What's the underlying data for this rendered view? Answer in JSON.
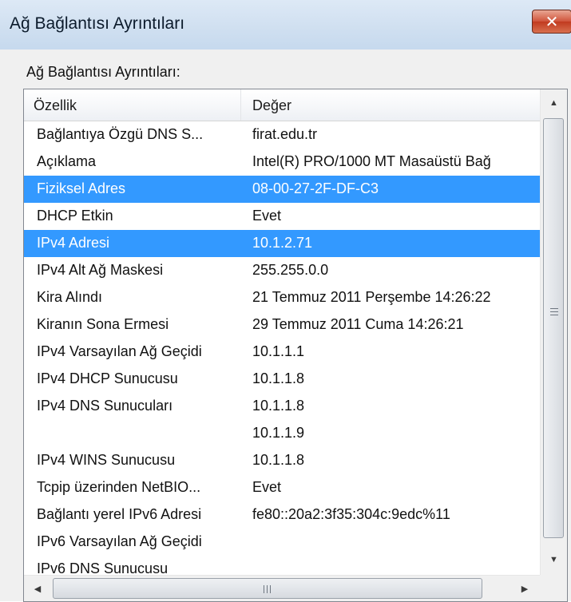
{
  "window": {
    "title": "Ağ Bağlantısı Ayrıntıları",
    "close_label": "✕"
  },
  "group_label": "Ağ Bağlantısı Ayrıntıları:",
  "table": {
    "columns": [
      "Özellik",
      "Değer"
    ],
    "rows": [
      {
        "property": "Bağlantıya Özgü DNS S...",
        "value": "firat.edu.tr",
        "selected": false
      },
      {
        "property": "Açıklama",
        "value": "Intel(R) PRO/1000 MT Masaüstü Bağ",
        "selected": false
      },
      {
        "property": "Fiziksel Adres",
        "value": "08-00-27-2F-DF-C3",
        "selected": true
      },
      {
        "property": "DHCP Etkin",
        "value": "Evet",
        "selected": false
      },
      {
        "property": "IPv4 Adresi",
        "value": "10.1.2.71",
        "selected": true
      },
      {
        "property": "IPv4 Alt Ağ Maskesi",
        "value": "255.255.0.0",
        "selected": false
      },
      {
        "property": "Kira Alındı",
        "value": "21 Temmuz 2011 Perşembe 14:26:22",
        "selected": false
      },
      {
        "property": "Kiranın Sona Ermesi",
        "value": "29 Temmuz 2011 Cuma 14:26:21",
        "selected": false
      },
      {
        "property": "IPv4 Varsayılan Ağ Geçidi",
        "value": "10.1.1.1",
        "selected": false
      },
      {
        "property": "IPv4 DHCP Sunucusu",
        "value": "10.1.1.8",
        "selected": false
      },
      {
        "property": "IPv4 DNS Sunucuları",
        "value": "10.1.1.8",
        "selected": false
      },
      {
        "property": "",
        "value": "10.1.1.9",
        "selected": false
      },
      {
        "property": "IPv4 WINS Sunucusu",
        "value": "10.1.1.8",
        "selected": false
      },
      {
        "property": "Tcpip üzerinden NetBIO...",
        "value": "Evet",
        "selected": false
      },
      {
        "property": "Bağlantı yerel IPv6 Adresi",
        "value": "fe80::20a2:3f35:304c:9edc%11",
        "selected": false
      },
      {
        "property": "IPv6 Varsayılan Ağ Geçidi",
        "value": "",
        "selected": false
      },
      {
        "property": "IPv6 DNS Sunucusu",
        "value": "",
        "selected": false
      }
    ]
  },
  "scrollbars": {
    "up_arrow": "▲",
    "down_arrow": "▼",
    "left_arrow": "◀",
    "right_arrow": "▶"
  },
  "colors": {
    "selection": "#3399ff",
    "close_button": "#c13a1f"
  }
}
